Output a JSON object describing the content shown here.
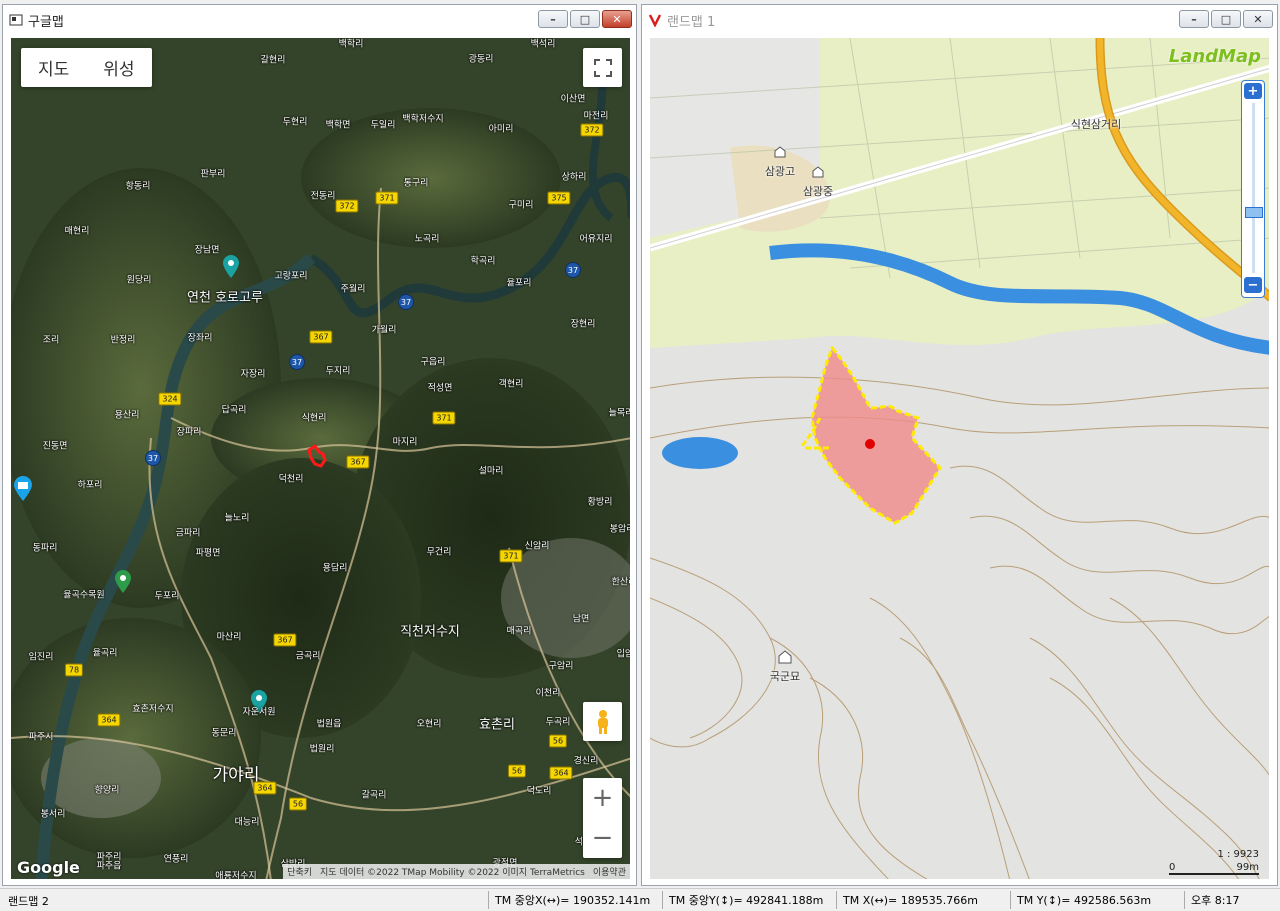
{
  "left_window": {
    "title": "구글맵",
    "map_type": {
      "map": "지도",
      "satellite": "위성"
    },
    "google": "Google",
    "attribution": {
      "shortcuts": "단축키",
      "data": "지도 데이터 ©2022 TMap Mobility ©2022 이미지 TerraMetrics",
      "terms": "이용약관"
    },
    "places": [
      "백학리",
      "광동리",
      "백석리",
      "갈현리",
      "이산면",
      "두현리",
      "백학면",
      "두일리",
      "백학저수지",
      "아미리",
      "마전리",
      "판부리",
      "통구리",
      "상하리",
      "항동리",
      "전동리",
      "구미리",
      "매현리",
      "노곡리",
      "어유지리",
      "장남면",
      "학곡리",
      "고랑포리",
      "원당리",
      "율포리",
      "연천 호로고루",
      "주월리",
      "조리",
      "반정리",
      "장좌리",
      "가월리",
      "장현리",
      "구읍리",
      "자장리",
      "두지리",
      "적성면",
      "객현리",
      "용산리",
      "답곡리",
      "늘목리",
      "식현리",
      "장파리",
      "진동면",
      "마지리",
      "덕천리",
      "설마리",
      "하포리",
      "황방리",
      "동파리",
      "늘노리",
      "금파리",
      "봉암리",
      "파평면",
      "무건리",
      "신암리",
      "용담리",
      "한산리",
      "율곡수목원",
      "두포리",
      "직천저수지",
      "남면",
      "마산리",
      "매곡리",
      "임진리",
      "금곡리",
      "구암리",
      "입암리",
      "율곡리",
      "효촌저수지",
      "이천리",
      "자운서원",
      "법원읍",
      "오현리",
      "효촌리",
      "두곡리",
      "파주시",
      "동문리",
      "법원리",
      "가야리",
      "경신리",
      "덕도리",
      "향양리",
      "갈곡리",
      "봉서리",
      "대능리",
      "석우",
      "파주리",
      "연풍리",
      "삼방리",
      "광적면",
      "애룡저수지",
      "파주읍"
    ],
    "routes": [
      "372",
      "371",
      "372",
      "375",
      "37",
      "37",
      "367",
      "37",
      "324",
      "371",
      "37",
      "367",
      "371",
      "364",
      "367",
      "78",
      "364",
      "56",
      "364",
      "56",
      "56"
    ]
  },
  "right_window": {
    "title": "랜드맵 1",
    "logo": "LandMap",
    "labels": [
      "식현삼거리",
      "삼광고",
      "삼광중",
      "국군묘"
    ],
    "scale": {
      "ratio": "1 : 9923",
      "zero": "0",
      "dist": "99m"
    },
    "zoom_in": "+",
    "zoom_out": "−"
  },
  "statusbar": {
    "title": "랜드맵 2",
    "fields": [
      "TM 중앙X(↔)= 190352.141m",
      "TM 중앙Y(↕)= 492841.188m",
      "TM X(↔)= 189535.766m",
      "TM Y(↕)= 492586.563m",
      "오후 8:17"
    ]
  },
  "colors": {
    "parcel_fill": "#f08a8a",
    "parcel_border": "#ffeb00",
    "river": "#3a8fe0",
    "highway": "#f2b52a"
  }
}
